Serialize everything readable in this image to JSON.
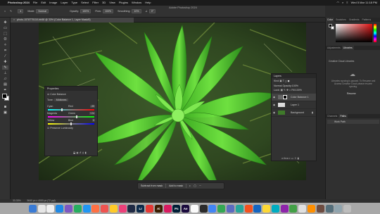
{
  "menubar": {
    "app_name": "Photoshop 2024",
    "items": [
      "File",
      "Edit",
      "Image",
      "Layer",
      "Type",
      "Select",
      "Filter",
      "3D",
      "View",
      "Plugins",
      "Window",
      "Help"
    ],
    "datetime": "Wed 5 Mar 11:18 PM"
  },
  "window": {
    "title": "Adobe Photoshop 2024"
  },
  "options_bar": {
    "mode_label": "Mode:",
    "mode_value": "Normal",
    "opacity_label": "Opacity:",
    "opacity_value": "100%",
    "flow_label": "Flow:",
    "flow_value": "100%",
    "smoothing_label": "Smoothing:",
    "smoothing_value": "10%",
    "angle_value": "0°"
  },
  "document": {
    "tab_title": "photo-1578775110-bb58 @ 33% (Color Balance 1, Layer Mask/8)",
    "zoom": "33.33%",
    "info": "5640 px x 4000 px (72 ppi)"
  },
  "context_bar": {
    "subtract_label": "Subtract from mask",
    "add_label": "Add to mask"
  },
  "properties": {
    "title": "Properties",
    "adjustment_name": "Color Balance",
    "tone_label": "Tone:",
    "tone_value": "Midtones",
    "sliders": [
      {
        "left": "Cyan",
        "right": "Red",
        "value": "-35",
        "pos": 0.3
      },
      {
        "left": "Magenta",
        "right": "Green",
        "value": "+24",
        "pos": 0.62
      },
      {
        "left": "Yellow",
        "right": "Blue",
        "value": "0",
        "pos": 0.5
      }
    ],
    "preserve_luminosity": "Preserve Luminosity"
  },
  "layers": {
    "title": "Layers",
    "kind_label": "Kind",
    "blend_mode": "Normal",
    "opacity_label": "Opacity:",
    "opacity_value": "100%",
    "lock_label": "Lock:",
    "fill_label": "Fill:",
    "fill_value": "100%",
    "rows": [
      {
        "name": "Color Balance 1"
      },
      {
        "name": "Layer 1"
      },
      {
        "name": "Background"
      }
    ]
  },
  "right_panels": {
    "color_tabs": [
      "Color",
      "Swatches",
      "Gradients",
      "Patterns"
    ],
    "adjust_tabs": [
      "Adjustments",
      "Libraries"
    ],
    "libraries_title": "Creative Cloud Libraries",
    "libraries_body": "Libraries syncing is paused. To Resume and Access Creative Cloud please resume syncing.",
    "resume_label": "Resume",
    "bottom_tabs": [
      "Channels",
      "Paths"
    ],
    "path_item": "Work Path"
  },
  "dock": {
    "apps": [
      {
        "label": "",
        "color": "#3a7bd5"
      },
      {
        "label": "",
        "color": "#e6e6e6"
      },
      {
        "label": "",
        "color": "#f0f0f0"
      },
      {
        "label": "",
        "color": "#1e88e5"
      },
      {
        "label": "",
        "color": "#7e57c2"
      },
      {
        "label": "",
        "color": "#27ae60"
      },
      {
        "label": "",
        "color": "#2196f3"
      },
      {
        "label": "",
        "color": "#ff7043"
      },
      {
        "label": "",
        "color": "#ef5350"
      },
      {
        "label": "",
        "color": "#ffca28"
      },
      {
        "label": "",
        "color": "#ec407a"
      },
      {
        "label": "",
        "color": "#1f2a44"
      },
      {
        "label": "Lr",
        "color": "#0c2b4b"
      },
      {
        "label": "",
        "color": "#e53935"
      },
      {
        "label": "Ai",
        "color": "#3b1d00"
      },
      {
        "label": "",
        "color": "#d81b60"
      },
      {
        "label": "Ps",
        "color": "#001e36"
      },
      {
        "label": "Ae",
        "color": "#1a0a3d"
      },
      {
        "label": "",
        "color": "#fafafa"
      },
      {
        "label": "",
        "color": "#2b2b2b"
      },
      {
        "label": "",
        "color": "#4285f4"
      },
      {
        "label": "",
        "color": "#34a853"
      },
      {
        "label": "",
        "color": "#5c6bc0"
      },
      {
        "label": "",
        "color": "#26a69a"
      },
      {
        "label": "",
        "color": "#f4511e"
      },
      {
        "label": "",
        "color": "#1565c0"
      },
      {
        "label": "",
        "color": "#fdd835"
      },
      {
        "label": "",
        "color": "#00acc1"
      },
      {
        "label": "",
        "color": "#8e24aa"
      },
      {
        "label": "",
        "color": "#43a047"
      },
      {
        "label": "",
        "color": "#e0e0e0"
      },
      {
        "label": "",
        "color": "#ff8f00"
      },
      {
        "label": "",
        "color": "#6d4c41"
      },
      {
        "label": "",
        "color": "#546e7a"
      },
      {
        "label": "",
        "color": "#90a4ae"
      },
      {
        "label": "",
        "color": "#bdbdbd"
      }
    ]
  }
}
